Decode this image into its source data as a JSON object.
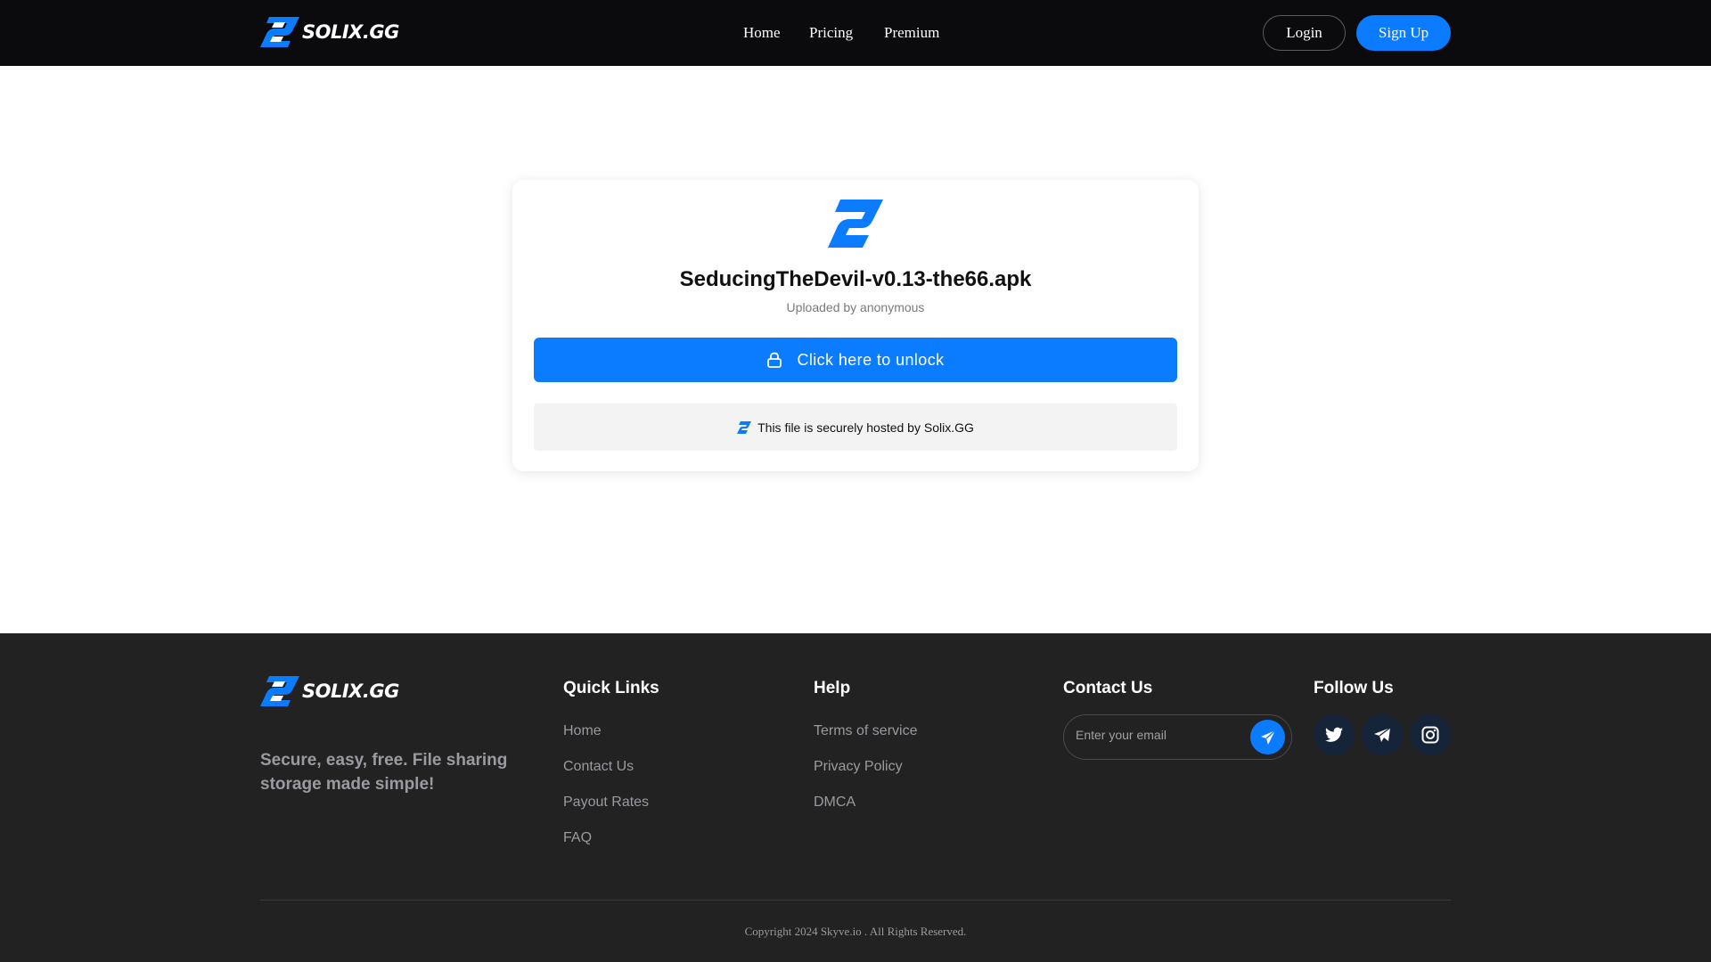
{
  "brand": {
    "name": "SOLIX.GG",
    "accent_color": "#0b7cff"
  },
  "nav": {
    "home": "Home",
    "pricing": "Pricing",
    "premium": "Premium"
  },
  "auth": {
    "login": "Login",
    "signup": "Sign Up"
  },
  "file": {
    "name": "SeducingTheDevil-v0.13-the66.apk",
    "uploader": "Uploaded by anonymous",
    "unlock_label": "Click here to unlock",
    "unlock_icon": "lock-icon",
    "hosted_note": "This file is securely hosted by Solix.GG"
  },
  "footer": {
    "tagline": "Secure, easy, free. File sharing storage made simple!",
    "quick_links": {
      "title": "Quick Links",
      "items": [
        "Home",
        "Contact Us",
        "Payout Rates",
        "FAQ"
      ]
    },
    "help": {
      "title": "Help",
      "items": [
        "Terms of service",
        "Privacy Policy",
        "DMCA"
      ]
    },
    "contact": {
      "title": "Contact Us",
      "email_placeholder": "Enter your email",
      "send_icon": "paper-plane-icon"
    },
    "follow": {
      "title": "Follow Us",
      "icons": [
        "twitter-icon",
        "telegram-icon",
        "instagram-icon"
      ]
    },
    "copyright": "Copyright 2024 Skyve.io . All Rights Reserved."
  }
}
